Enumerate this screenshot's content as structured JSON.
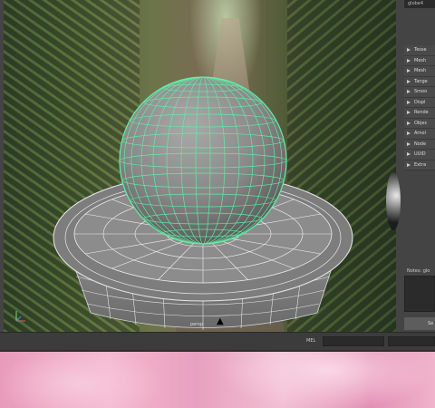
{
  "panel": {
    "title": "globe4",
    "attributes": [
      {
        "label": "Tesse"
      },
      {
        "label": "Mesh"
      },
      {
        "label": "Mesh"
      },
      {
        "label": "Tange"
      },
      {
        "label": "Smoo"
      },
      {
        "label": "Displ"
      },
      {
        "label": "Rende"
      },
      {
        "label": "Objec"
      },
      {
        "label": "Arnol"
      },
      {
        "label": "Node"
      },
      {
        "label": "UUID"
      },
      {
        "label": "Extra"
      }
    ],
    "notes_label": "Notes: glo",
    "select_label": "Se"
  },
  "viewport": {
    "camera_label": "persp",
    "cursor_icon": "pointer-cursor-icon",
    "gizmo_icon": "axis-gizmo-icon"
  },
  "statusbar": {
    "mel_label": "MEL"
  },
  "colors": {
    "wireframe_selected": "#5ff0a5",
    "wireframe_default": "#ffffff",
    "mesh_fill": "#8a8a8a",
    "panel_bg": "#444444"
  }
}
